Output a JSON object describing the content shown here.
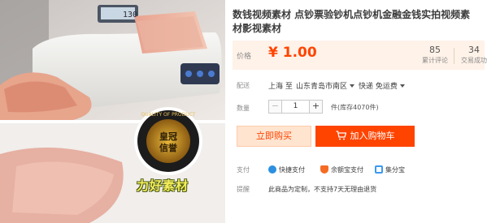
{
  "product": {
    "title": "数钱视频素材 点钞票验钞机点钞机金融金钱实拍视频素材影视素材",
    "watermark": "力好素材",
    "counter_display": "130"
  },
  "price": {
    "label": "价格",
    "currency": "¥",
    "value": "1.00",
    "reviews_count": "85",
    "reviews_label": "累计评论",
    "sales_count": "34",
    "sales_label": "交易成功"
  },
  "shipping": {
    "label": "配送",
    "from": "上海 至",
    "to": "山东青岛市南区",
    "courier": "快递 免运费"
  },
  "quantity": {
    "label": "数量",
    "minus": "−",
    "value": "1",
    "plus": "+",
    "unit_stock": "件(库存4070件)"
  },
  "actions": {
    "buy_now": "立即购买",
    "add_to_cart": "加入购物车"
  },
  "payment": {
    "label": "支付",
    "options": [
      "快捷支付",
      "余额宝支付",
      "集分宝"
    ]
  },
  "notice": {
    "label": "提醒",
    "text": "此商品为定制，不支持7天无理由退货"
  },
  "colors": {
    "accent": "#ff4400",
    "price_bg": "#fff2e8",
    "buy_now_bg": "#ffe4d0"
  }
}
